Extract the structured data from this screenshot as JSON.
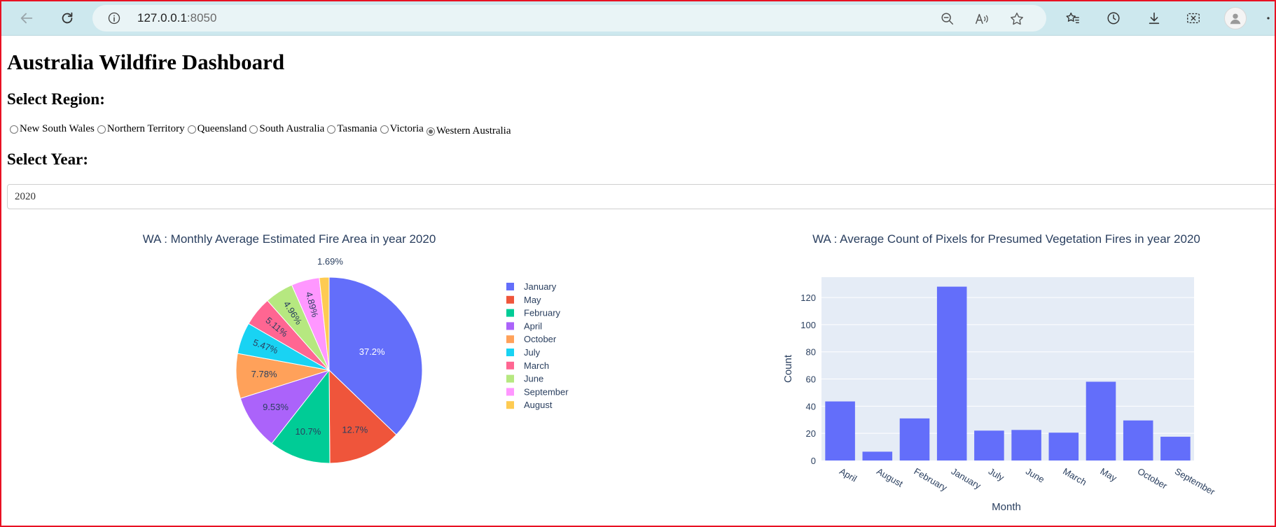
{
  "browser": {
    "url_host": "127.0.0.1",
    "url_port": ":8050",
    "icons": [
      "back-arrow-icon",
      "reload-icon",
      "info-icon",
      "zoom-out-icon",
      "read-aloud-icon",
      "favorite-star-icon",
      "favorites-icon",
      "history-icon",
      "download-icon",
      "screenshot-icon",
      "profile-icon",
      "more-icon"
    ]
  },
  "page": {
    "title": "Australia Wildfire Dashboard",
    "region_label": "Select Region:",
    "year_label": "Select Year:",
    "regions": [
      {
        "label": "New South Wales",
        "checked": false
      },
      {
        "label": "Northern Territory",
        "checked": false
      },
      {
        "label": "Queensland",
        "checked": false
      },
      {
        "label": "South Australia",
        "checked": false
      },
      {
        "label": "Tasmania",
        "checked": false
      },
      {
        "label": "Victoria",
        "checked": false
      },
      {
        "label": "Western Australia",
        "checked": true
      }
    ],
    "year_value": "2020"
  },
  "chart_data": [
    {
      "type": "pie",
      "title": "WA : Monthly Average Estimated Fire Area in year 2020",
      "labels": [
        "January",
        "May",
        "February",
        "April",
        "October",
        "July",
        "March",
        "June",
        "September",
        "August"
      ],
      "values": [
        37.2,
        12.7,
        10.7,
        9.53,
        7.78,
        5.47,
        5.11,
        4.96,
        4.89,
        1.69
      ],
      "text_labels": [
        "37.2%",
        "12.7%",
        "10.7%",
        "9.53%",
        "7.78%",
        "5.47%",
        "5.11%",
        "4.96%",
        "4.89%",
        "1.69%"
      ],
      "colors": [
        "#636efa",
        "#ef553b",
        "#00cc96",
        "#ab63fa",
        "#ffa15a",
        "#19d3f3",
        "#ff6692",
        "#b6e880",
        "#ff97ff",
        "#fecb52"
      ],
      "legend": "right"
    },
    {
      "type": "bar",
      "title": "WA : Average Count of Pixels for Presumed Vegetation Fires in year 2020",
      "categories": [
        "April",
        "August",
        "February",
        "January",
        "July",
        "June",
        "March",
        "May",
        "October",
        "September"
      ],
      "values": [
        43.5,
        6.5,
        31,
        128,
        22,
        22.5,
        20.5,
        58,
        29.5,
        17.5
      ],
      "xlabel": "Month",
      "ylabel": "Count",
      "ylim": [
        0,
        135
      ],
      "yticks": [
        0,
        20,
        40,
        60,
        80,
        100,
        120
      ],
      "color": "#636efa",
      "plot_bg": "#e5ecf6",
      "grid": true
    }
  ]
}
